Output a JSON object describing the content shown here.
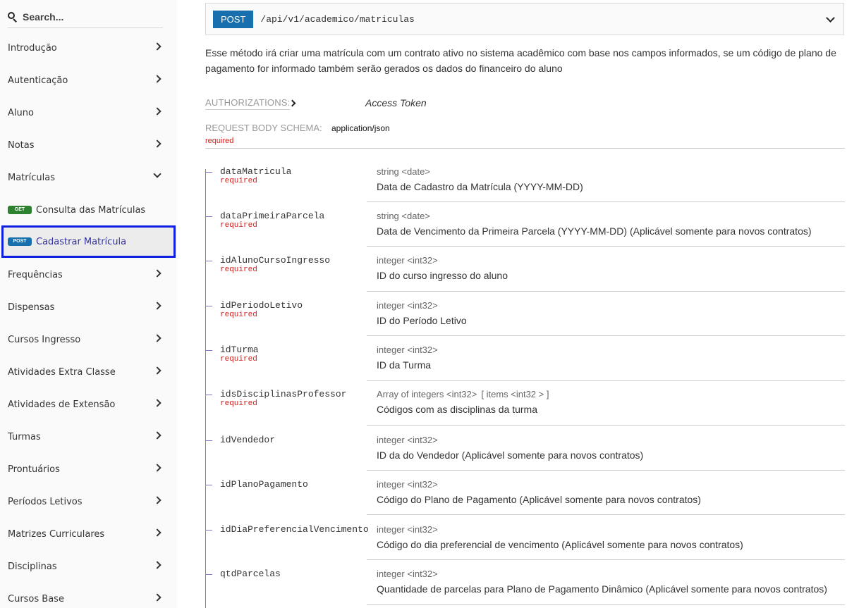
{
  "sidebar": {
    "search_placeholder": "Search...",
    "items": [
      {
        "label": "Introdução"
      },
      {
        "label": "Autenticação"
      },
      {
        "label": "Aluno"
      },
      {
        "label": "Notas"
      },
      {
        "label": "Matrículas",
        "expanded": true
      },
      {
        "label": "Frequências"
      },
      {
        "label": "Dispensas"
      },
      {
        "label": "Cursos Ingresso"
      },
      {
        "label": "Atividades Extra Classe"
      },
      {
        "label": "Atividades de Extensão"
      },
      {
        "label": "Turmas"
      },
      {
        "label": "Prontuários"
      },
      {
        "label": "Períodos Letivos"
      },
      {
        "label": "Matrizes Curriculares"
      },
      {
        "label": "Disciplinas"
      },
      {
        "label": "Cursos Base"
      }
    ],
    "subitems": [
      {
        "badge": "GET",
        "label": "Consulta das Matrículas"
      },
      {
        "badge": "POST",
        "label": "Cadastrar Matrícula",
        "active": true
      }
    ]
  },
  "endpoint": {
    "method": "POST",
    "path": "/api/v1/academico/matriculas"
  },
  "description": "Esse método irá criar uma matrícula com um contrato ativo no sistema acadêmico com base nos campos informados, se um código de plano de pagamento for informado também serão gerados os dados do financeiro do aluno",
  "authorizations": {
    "label": "AUTHORIZATIONS:",
    "value": "Access Token"
  },
  "request_body": {
    "label": "REQUEST BODY SCHEMA:",
    "content_type": "application/json",
    "required": "required"
  },
  "params": [
    {
      "name": "dataMatricula",
      "required": "required",
      "type": "string <date>",
      "items": "",
      "description": "Data de Cadastro da Matrícula (YYYY-MM-DD)"
    },
    {
      "name": "dataPrimeiraParcela",
      "required": "required",
      "type": "string <date>",
      "items": "",
      "description": "Data de Vencimento da Primeira Parcela (YYYY-MM-DD) (Aplicável somente para novos contratos)"
    },
    {
      "name": "idAlunoCursoIngresso",
      "required": "required",
      "type": "integer <int32>",
      "items": "",
      "description": "ID do curso ingresso do aluno"
    },
    {
      "name": "idPeriodoLetivo",
      "required": "required",
      "type": "integer <int32>",
      "items": "",
      "description": "ID do Período Letivo"
    },
    {
      "name": "idTurma",
      "required": "required",
      "type": "integer <int32>",
      "items": "",
      "description": "ID da Turma"
    },
    {
      "name": "idsDisciplinasProfessor",
      "required": "required",
      "type": "Array of integers <int32>",
      "items": "[ items <int32 > ]",
      "description": "Códigos com as disciplinas da turma"
    },
    {
      "name": "idVendedor",
      "required": "",
      "type": "integer <int32>",
      "items": "",
      "description": "ID da do Vendedor (Aplicável somente para novos contratos)"
    },
    {
      "name": "idPlanoPagamento",
      "required": "",
      "type": "integer <int32>",
      "items": "",
      "description": "Código do Plano de Pagamento (Aplicável somente para novos contratos)"
    },
    {
      "name": "idDiaPreferencialVencimento",
      "required": "",
      "type": "integer <int32>",
      "items": "",
      "description": "Código do dia preferencial de vencimento (Aplicável somente para novos contratos)"
    },
    {
      "name": "qtdParcelas",
      "required": "",
      "type": "integer <int32>",
      "items": "",
      "description": "Quantidade de parcelas para Plano de Pagamento Dinâmico (Aplicável somente para novos contratos)"
    }
  ]
}
